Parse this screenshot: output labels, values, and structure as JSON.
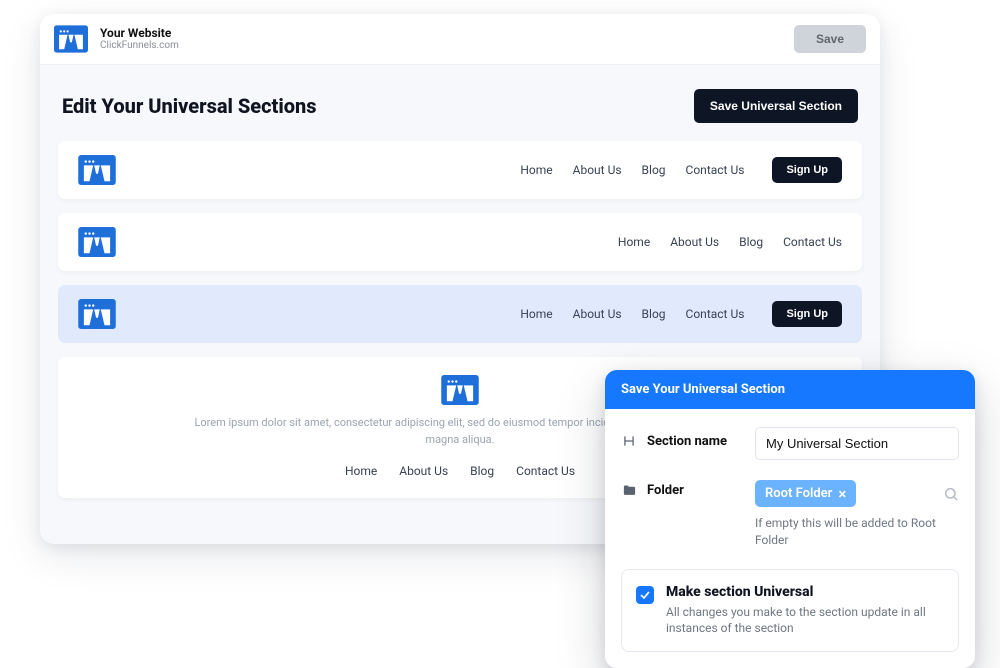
{
  "header": {
    "site_title": "Your Website",
    "site_sub": "ClickFunnels.com",
    "save_label": "Save"
  },
  "page": {
    "title": "Edit Your Universal Sections",
    "save_universal_label": "Save Universal Section"
  },
  "nav_items": [
    "Home",
    "About Us",
    "Blog",
    "Contact Us"
  ],
  "sign_up_label": "Sign Up",
  "sections": [
    {
      "selected": false,
      "show_signup": true
    },
    {
      "selected": false,
      "show_signup": false
    },
    {
      "selected": true,
      "show_signup": true
    }
  ],
  "footer": {
    "desc": "Lorem ipsum dolor sit amet, consectetur adipiscing elit, sed do eiusmod tempor incididunt ut labore et dolore magna aliqua.",
    "nav": [
      "Home",
      "About Us",
      "Blog",
      "Contact Us"
    ]
  },
  "panel": {
    "title": "Save Your Universal Section",
    "section_name_label": "Section name",
    "section_name_value": "My Universal Section",
    "folder_label": "Folder",
    "folder_chip": "Root Folder",
    "folder_hint": "If empty this will be added to Root Folder",
    "universal_title": "Make section Universal",
    "universal_desc": "All changes you make to the section update in all instances of the section",
    "universal_checked": true
  }
}
